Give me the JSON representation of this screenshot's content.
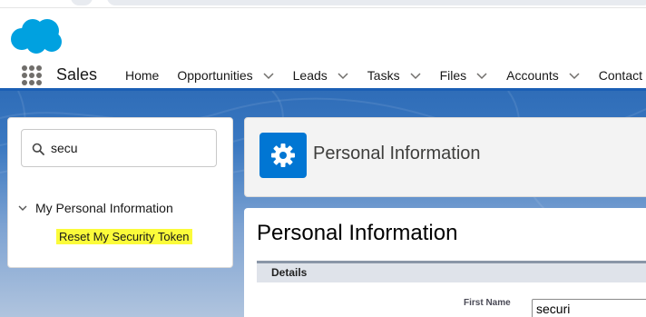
{
  "header": {
    "app_name": "Sales"
  },
  "nav": {
    "items": [
      {
        "label": "Home",
        "has_menu": false
      },
      {
        "label": "Opportunities",
        "has_menu": true
      },
      {
        "label": "Leads",
        "has_menu": true
      },
      {
        "label": "Tasks",
        "has_menu": true
      },
      {
        "label": "Files",
        "has_menu": true
      },
      {
        "label": "Accounts",
        "has_menu": true
      },
      {
        "label": "Contact",
        "has_menu": false
      }
    ]
  },
  "sidebar": {
    "search_value": "secu",
    "tree_parent": "My Personal Information",
    "tree_child": "Reset My Security Token"
  },
  "page_header": {
    "title": "Personal Information"
  },
  "main": {
    "heading": "Personal Information",
    "section_title": "Details",
    "field_label": "First Name",
    "field_value": "securi"
  },
  "colors": {
    "brand_blue": "#0176d3",
    "logo_blue": "#00a1e0",
    "highlight": "#fbfb3a"
  },
  "icons": {
    "logo": "salesforce-cloud-icon",
    "launcher": "app-launcher-icon",
    "search": "search-icon",
    "settings": "gear-icon"
  }
}
